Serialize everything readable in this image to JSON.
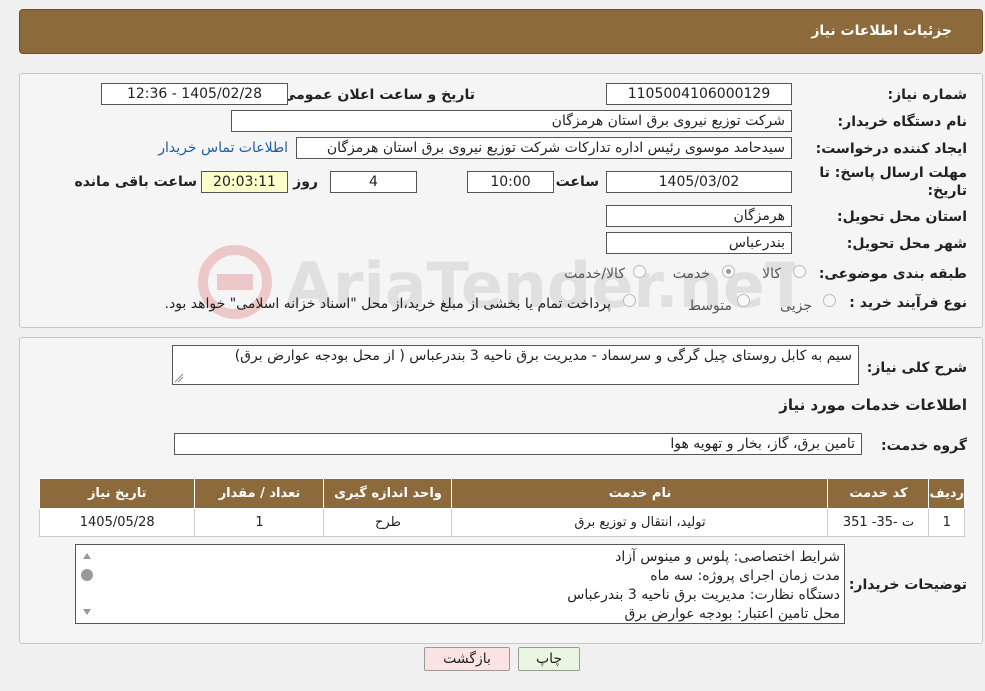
{
  "header": {
    "title": "جزئیات اطلاعات نیاز"
  },
  "fields": {
    "need_number_label": "شماره نیاز:",
    "need_number": "1105004106000129",
    "announce_label": "تاریخ و ساعت اعلان عمومی:",
    "announce_value": "1405/02/28 - 12:36",
    "buyer_org_label": "نام دستگاه خریدار:",
    "buyer_org": "شرکت توزیع نیروی برق استان هرمزگان",
    "creator_label": "ایجاد کننده درخواست:",
    "creator": "سیدحامد موسوی رئیس اداره تدارکات شرکت توزیع نیروی برق استان هرمزگان",
    "contact_link": "اطلاعات تماس خریدار",
    "deadline_label_1": "مهلت ارسال پاسخ: تا",
    "deadline_label_2": "تاریخ:",
    "deadline_date": "1405/03/02",
    "hour_label": "ساعت",
    "deadline_time": "10:00",
    "days_value": "4",
    "days_label": "روز و",
    "remaining_time": "20:03:11",
    "remaining_label": "ساعت باقی مانده",
    "province_label": "استان محل تحویل:",
    "province": "هرمزگان",
    "city_label": "شهر محل تحویل:",
    "city": "بندرعباس",
    "category_label": "طبقه بندی موضوعی:",
    "cat_goods": "کالا",
    "cat_service": "خدمت",
    "cat_both": "کالا/خدمت",
    "process_label": "نوع فرآیند خرید :",
    "proc_partial": "جزیی",
    "proc_medium": "متوسط",
    "payment_note": "پرداخت تمام یا بخشی از مبلغ خرید،از محل \"اسناد خزانه اسلامی\" خواهد بود."
  },
  "summary": {
    "label": "شرح کلی نیاز:",
    "text": "سیم به کابل روستای چیل گرگی و سرسماد - مدیریت برق ناحیه 3 بندرعباس ( از محل بودجه عوارض برق)"
  },
  "services": {
    "section_title": "اطلاعات خدمات مورد نیاز",
    "group_label": "گروه خدمت:",
    "group_value": "تامین برق، گاز، بخار و تهویه هوا",
    "table": {
      "headers": [
        "ردیف",
        "کد خدمت",
        "نام خدمت",
        "واحد اندازه گیری",
        "تعداد / مقدار",
        "تاریخ نیاز"
      ],
      "rows": [
        [
          "1",
          "ت -35- 351",
          "تولید، انتقال و توزیع برق",
          "طرح",
          "1",
          "1405/05/28"
        ]
      ]
    }
  },
  "notes": {
    "label": "توضیحات خریدار:",
    "lines": [
      "شرایط اختصاصی: پلوس و مینوس آزاد",
      "مدت زمان اجرای پروژه: سه ماه",
      "دستگاه نظارت: مدیریت برق ناحیه 3 بندرعباس",
      "محل تامین اعتبار: بودجه عوارض برق"
    ]
  },
  "buttons": {
    "print": "چاپ",
    "back": "بازگشت"
  },
  "colors": {
    "header_bg": "#8c6a3c",
    "back_btn_bg": "#fbe3e3",
    "print_btn_bg": "#e9f7e2"
  }
}
